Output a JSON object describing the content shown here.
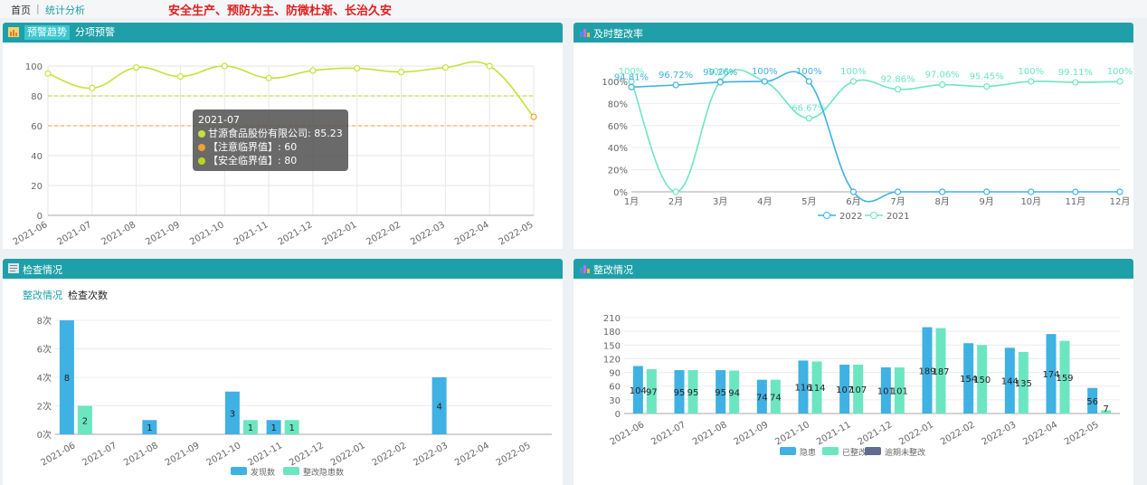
{
  "nav": {
    "home": "首页",
    "sep": "|",
    "current": "统计分析",
    "slogan": "安全生产、预防为主、防微杜渐、长治久安"
  },
  "panel_trend": {
    "tabs": [
      "预警趋势",
      "分项预警"
    ],
    "tooltip": {
      "title": "2021-07",
      "rows": [
        {
          "label": "甘源食品股份有限公司: 85.23",
          "color": "#c8e03a"
        },
        {
          "label": "【注意临界值】: 60",
          "color": "#f0a22e"
        },
        {
          "label": "【安全临界值】: 80",
          "color": "#b5d81e"
        }
      ]
    }
  },
  "panel_rate": {
    "title": "及时整改率"
  },
  "panel_inspect": {
    "title": "检查情况",
    "subtabs": [
      "整改情况",
      "检查次数"
    ]
  },
  "panel_fix": {
    "title": "整改情况"
  },
  "colors": {
    "teal": "#1fa0a8",
    "blue": "#3fb1e3",
    "mint": "#6be6c1",
    "navy": "#626c91",
    "line_main": "#c8e03a",
    "warn": "#f0a22e"
  },
  "chart_data": [
    {
      "type": "line",
      "x": [
        "2021-06",
        "2021-07",
        "2021-08",
        "2021-09",
        "2021-10",
        "2021-11",
        "2021-12",
        "2022-01",
        "2022-02",
        "2022-03",
        "2022-04",
        "2022-05"
      ],
      "series": [
        {
          "name": "甘源食品股份有限公司",
          "values": [
            95,
            85.23,
            99,
            93,
            100,
            92,
            97,
            98.5,
            96,
            99,
            100,
            66
          ]
        }
      ],
      "thresholds": [
        {
          "name": "【注意临界值】",
          "value": 60
        },
        {
          "name": "【安全临界值】",
          "value": 80
        }
      ],
      "ylim": [
        0,
        100
      ],
      "yticks": [
        "0",
        "20",
        "40",
        "60",
        "80",
        "100"
      ]
    },
    {
      "type": "line",
      "x": [
        "1月",
        "2月",
        "3月",
        "4月",
        "5月",
        "6月",
        "7月",
        "8月",
        "9月",
        "10月",
        "11月",
        "12月"
      ],
      "series": [
        {
          "name": "2022",
          "values": [
            94.81,
            96.72,
            99.26,
            100,
            100,
            0,
            0,
            0,
            0,
            0,
            0,
            0
          ]
        },
        {
          "name": "2021",
          "values": [
            100,
            0,
            100,
            100,
            66.67,
            100,
            92.86,
            97.06,
            95.45,
            100,
            99.11,
            100
          ]
        }
      ],
      "point_labels_2022": [
        "94.81%",
        "96.72%",
        "99.26%",
        "100%",
        "100%",
        "",
        "",
        "",
        "",
        "",
        "",
        ""
      ],
      "point_labels_2021": [
        "100%",
        "",
        "100%",
        "",
        "66.67%",
        "100%",
        "92.86%",
        "97.06%",
        "95.45%",
        "100%",
        "99.11%",
        "100%"
      ],
      "ylim": [
        0,
        100
      ],
      "yticks": [
        "0%",
        "20%",
        "40%",
        "60%",
        "80%",
        "100%"
      ]
    },
    {
      "type": "bar",
      "categories": [
        "2021-06",
        "2021-07",
        "2021-08",
        "2021-09",
        "2021-10",
        "2021-11",
        "2021-12",
        "2022-01",
        "2022-02",
        "2022-03",
        "2022-04",
        "2022-05"
      ],
      "series": [
        {
          "name": "发现数",
          "values": [
            8,
            0,
            1,
            0,
            3,
            1,
            0,
            0,
            0,
            4,
            0,
            0
          ]
        },
        {
          "name": "整改隐患数",
          "values": [
            2,
            0,
            0,
            0,
            1,
            1,
            0,
            0,
            0,
            0,
            0,
            0
          ]
        }
      ],
      "ylim": [
        0,
        8
      ],
      "yticks": [
        "0次",
        "2次",
        "4次",
        "6次",
        "8次"
      ]
    },
    {
      "type": "bar",
      "categories": [
        "2021-06",
        "2021-07",
        "2021-08",
        "2021-09",
        "2021-10",
        "2021-11",
        "2021-12",
        "2022-01",
        "2022-02",
        "2022-03",
        "2022-04",
        "2022-05"
      ],
      "series": [
        {
          "name": "隐患",
          "values": [
            104,
            95,
            95,
            74,
            116,
            107,
            101,
            189,
            154,
            144,
            174,
            56
          ]
        },
        {
          "name": "已整改",
          "values": [
            97,
            95,
            94,
            74,
            114,
            107,
            101,
            187,
            150,
            135,
            159,
            7
          ]
        },
        {
          "name": "逾期未整改",
          "values": [
            0,
            0,
            0,
            0,
            0,
            0,
            0,
            0,
            0,
            0,
            0,
            0
          ]
        }
      ],
      "ylim": [
        0,
        210
      ],
      "yticks": [
        "0",
        "30",
        "60",
        "90",
        "120",
        "150",
        "180",
        "210"
      ]
    }
  ]
}
